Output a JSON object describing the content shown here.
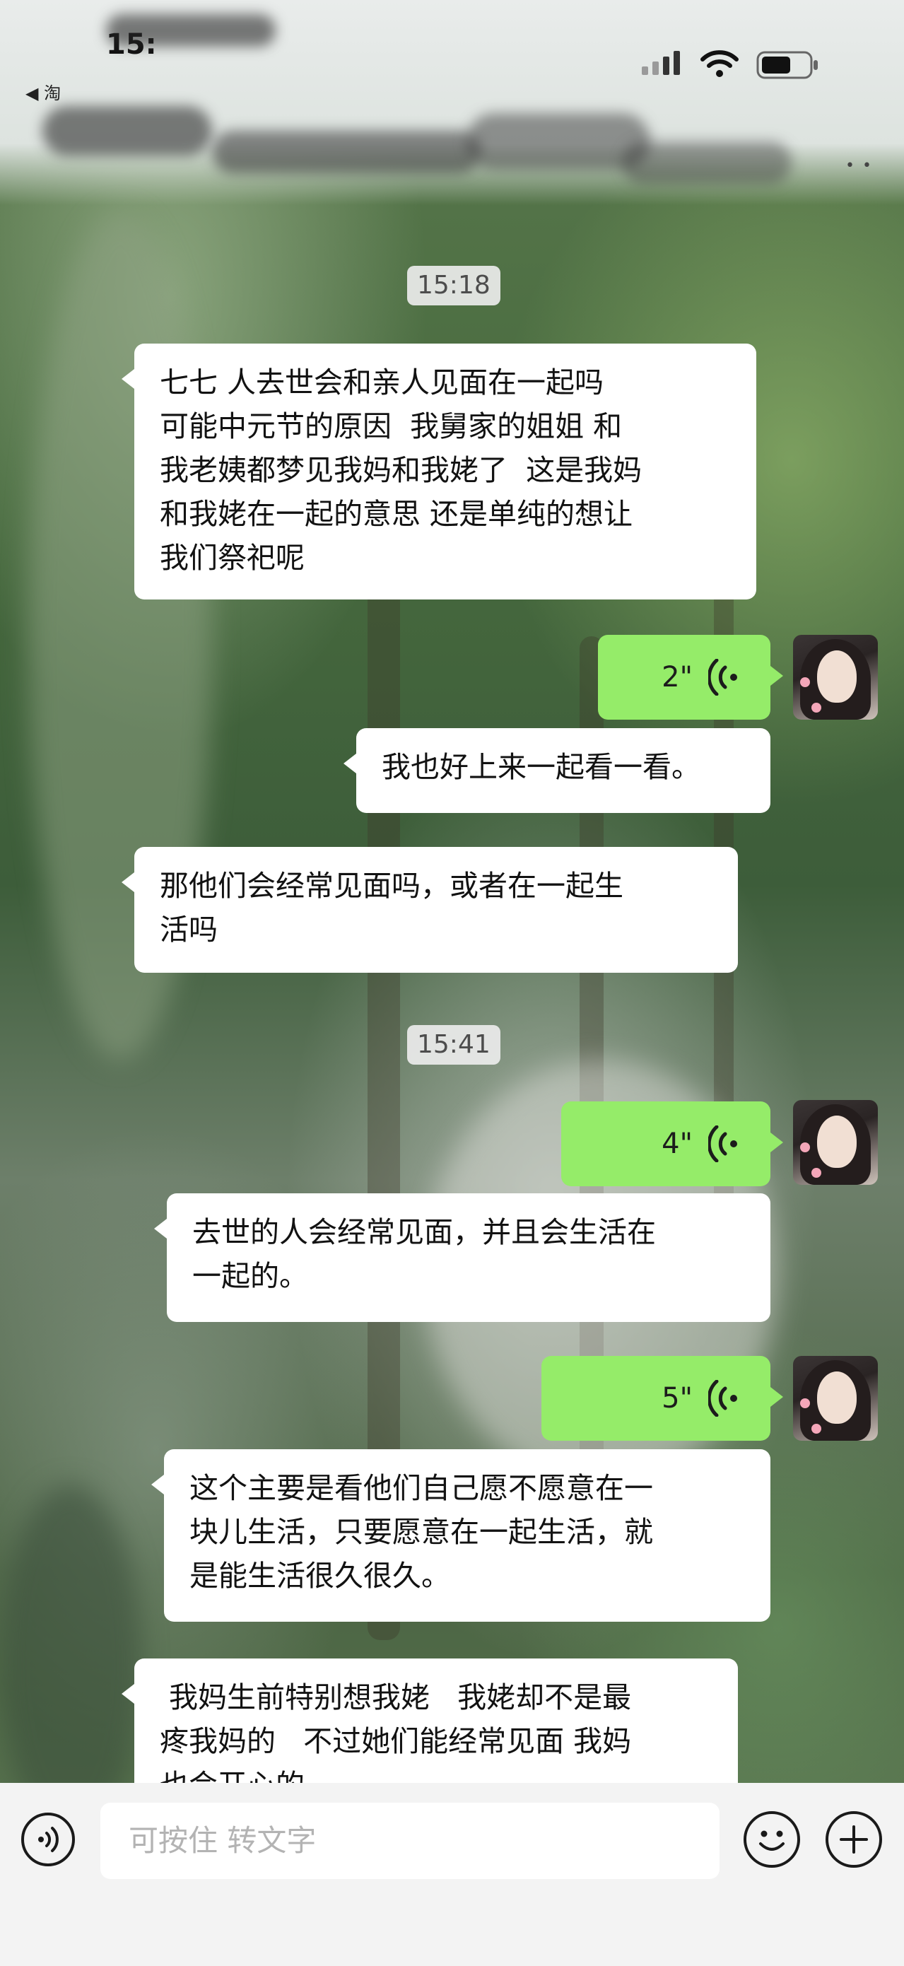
{
  "status_bar": {
    "time": "15:",
    "back_indicator": "◀ 淘",
    "more_icon": "more-dots-icon"
  },
  "messages": [
    {
      "kind": "time",
      "text": "15:18"
    },
    {
      "kind": "text",
      "side": "left",
      "text": "七七 人去世会和亲人见面在一起吗\n可能中元节的原因  我舅家的姐姐 和\n我老姨都梦见我妈和我姥了  这是我妈\n和我姥在一起的意思 还是单纯的想让\n我们祭祀呢"
    },
    {
      "kind": "voice",
      "side": "right",
      "duration": "2\""
    },
    {
      "kind": "text",
      "side": "right",
      "text": "我也好上来一起看一看。"
    },
    {
      "kind": "text",
      "side": "left",
      "text": "那他们会经常见面吗，或者在一起生\n活吗"
    },
    {
      "kind": "time",
      "text": "15:41"
    },
    {
      "kind": "voice",
      "side": "right",
      "duration": "4\""
    },
    {
      "kind": "text",
      "side": "left",
      "text": "去世的人会经常见面，并且会生活在\n一起的。"
    },
    {
      "kind": "voice",
      "side": "right",
      "duration": "5\""
    },
    {
      "kind": "text",
      "side": "left",
      "text": "这个主要是看他们自己愿不愿意在一\n块儿生活，只要愿意在一起生活，就\n是能生活很久很久。"
    },
    {
      "kind": "text",
      "side": "left",
      "text": " 我妈生前特别想我姥   我姥却不是最\n疼我妈的   不过她们能经常见面 我妈\n也会开心的。"
    }
  ],
  "input_bar": {
    "placeholder": "可按住 转文字",
    "voice_icon": "voice-mode-icon",
    "emoji_icon": "emoji-icon",
    "plus_icon": "plus-icon"
  },
  "colors": {
    "voice_bubble": "#95ec69",
    "text_bubble": "#ffffff",
    "input_bar": "#f3f3f3"
  }
}
